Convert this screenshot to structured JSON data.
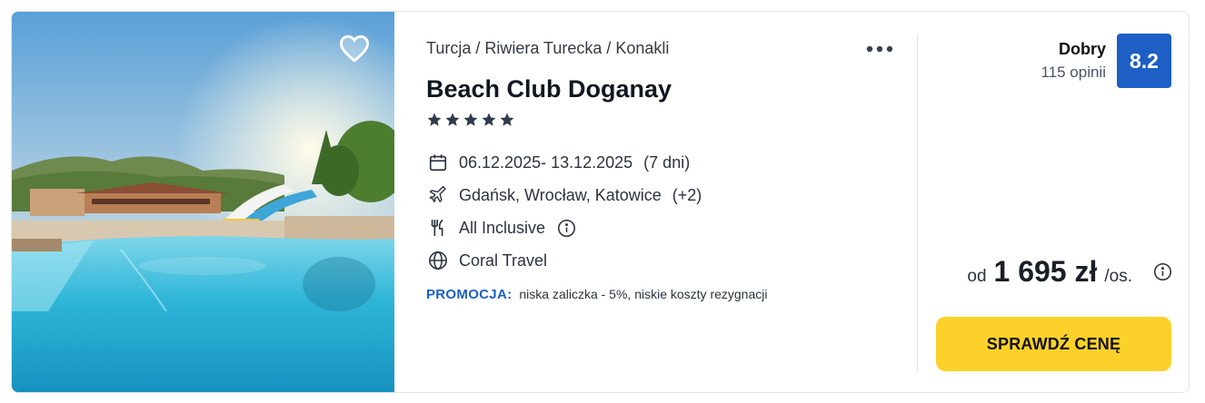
{
  "offer": {
    "breadcrumb": "Turcja / Riwiera Turecka / Konakli",
    "hotel_name": "Beach Club Doganay",
    "stars": 5,
    "dates": "06.12.2025- 13.12.2025",
    "duration": "(7 dni)",
    "departures": "Gdańsk, Wrocław, Katowice",
    "departures_extra": "(+2)",
    "board": "All Inclusive",
    "operator": "Coral Travel",
    "promo_label": "PROMOCJA:",
    "promo_text": "niska zaliczka - 5%, niskie koszty rezygnacji"
  },
  "rating": {
    "word": "Dobry",
    "reviews": "115 opinii",
    "score": "8.2"
  },
  "price": {
    "from": "od",
    "amount": "1 695 zł",
    "per": "/os.",
    "cta_label": "SPRAWDŹ CENĘ"
  },
  "colors": {
    "accent_blue": "#1d5fc4",
    "cta_yellow": "#fcd12a"
  },
  "icons": {
    "favorite": "heart-icon",
    "more": "more-dots-icon",
    "dates": "calendar-icon",
    "departures": "plane-icon",
    "board": "cutlery-icon",
    "operator": "globe-icon",
    "info": "info-icon",
    "stars": "star-icon"
  }
}
